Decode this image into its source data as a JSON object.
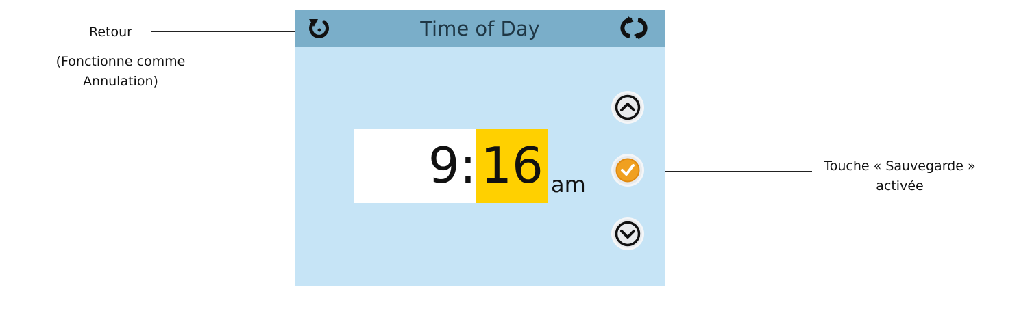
{
  "annotations": {
    "back_label": "Retour",
    "back_note": "(Fonctionne comme Annulation)",
    "save_note": "Touche « Sauvegarde » activée"
  },
  "screen": {
    "title": "Time of Day",
    "time": {
      "hours": "9:",
      "minutes": "16",
      "period": "am"
    },
    "icons": {
      "back": "back-icon",
      "refresh": "refresh-icon",
      "up": "chevron-up-icon",
      "save": "checkmark-icon",
      "down": "chevron-down-icon"
    },
    "colors": {
      "header": "#7aaec9",
      "background": "#c6e4f6",
      "selected_field": "#ffd000",
      "save_accent": "#f0a020"
    }
  }
}
